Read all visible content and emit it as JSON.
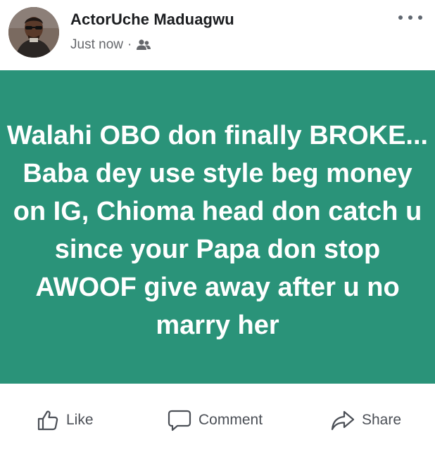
{
  "post": {
    "author": "ActorUche Maduagwu",
    "timestamp": "Just now",
    "separator": "·",
    "audience_icon": "friends-icon",
    "background_color": "#2a9379",
    "text": "Walahi OBO don finally BROKE... Baba dey use style beg money on IG, Chioma head don catch u since your Papa don stop AWOOF give away after u no marry her"
  },
  "actions": {
    "like_label": "Like",
    "comment_label": "Comment",
    "share_label": "Share"
  }
}
